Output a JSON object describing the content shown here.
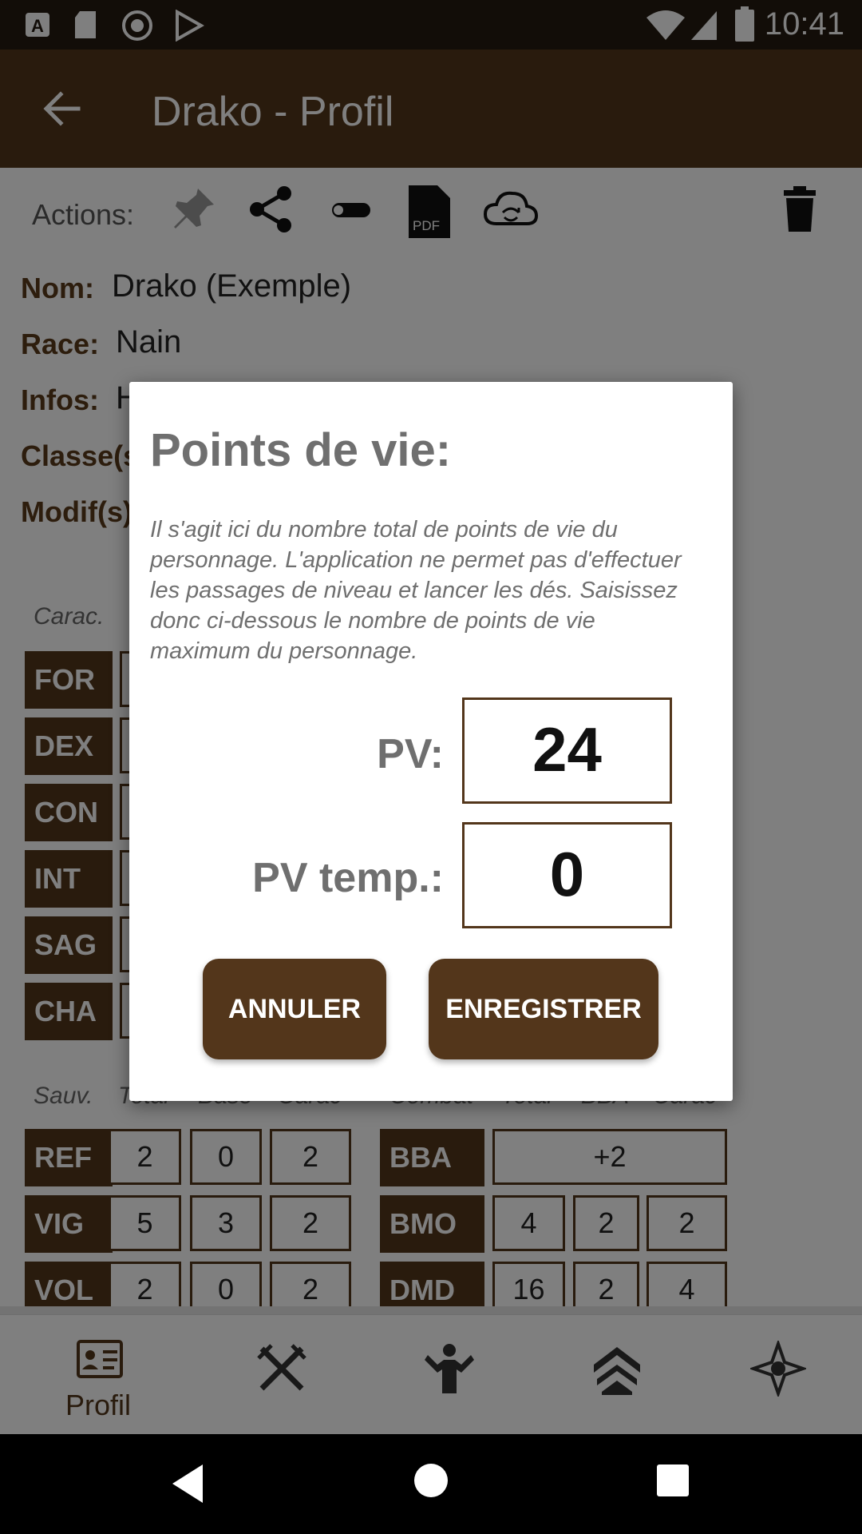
{
  "status_bar": {
    "time": "10:41"
  },
  "app_bar": {
    "title": "Drako - Profil",
    "back_icon": "arrow-back-icon"
  },
  "actions": {
    "label": "Actions:",
    "icons": [
      "pin-icon",
      "share-icon",
      "toggle-icon",
      "pdf-icon",
      "cloud-sync-icon",
      "trash-icon"
    ],
    "pdf_text": "PDF"
  },
  "info": {
    "nom_label": "Nom:",
    "nom_value": "Drako (Exemple)",
    "race_label": "Race:",
    "race_value": "Nain",
    "infos_label": "Infos:",
    "infos_value": "H",
    "classes_label": "Classe(s",
    "modifs_label": "Modif(s)"
  },
  "carac": {
    "header": "Carac.",
    "stats": [
      "FOR",
      "DEX",
      "CON",
      "INT",
      "SAG",
      "CHA"
    ]
  },
  "saves": {
    "headers": [
      "Sauv.",
      "Total",
      "Base",
      "Carac"
    ],
    "rows": [
      {
        "name": "REF",
        "total": "2",
        "base": "0",
        "carac": "2"
      },
      {
        "name": "VIG",
        "total": "5",
        "base": "3",
        "carac": "2"
      },
      {
        "name": "VOL",
        "total": "2",
        "base": "0",
        "carac": "2"
      }
    ]
  },
  "combat": {
    "headers": [
      "Combat",
      "Total",
      "BBA",
      "Carac"
    ],
    "bba": {
      "name": "BBA",
      "value": "+2"
    },
    "rows": [
      {
        "name": "BMO",
        "total": "4",
        "bba": "2",
        "carac": "2"
      },
      {
        "name": "DMD",
        "total": "16",
        "bba": "2",
        "carac": "4"
      }
    ]
  },
  "bottom_nav": {
    "items": [
      "profile-card-icon",
      "swords-icon",
      "strongman-icon",
      "levels-chevron-icon",
      "magic-star-icon"
    ],
    "profil_label": "Profil"
  },
  "dialog": {
    "title": "Points de vie:",
    "description": "Il s'agit ici du nombre total de points de vie du personnage. L'application ne permet pas d'effectuer les passages de niveau et lancer les dés. Saisissez donc ci-dessous le nombre de points de vie maximum du personnage.",
    "pv_label": "PV:",
    "pv_value": "24",
    "pv_temp_label": "PV temp.:",
    "pv_temp_value": "0",
    "cancel_label": "ANNULER",
    "save_label": "ENREGISTRER"
  },
  "colors": {
    "brand": "#53361b",
    "status_bar": "#241a10"
  }
}
